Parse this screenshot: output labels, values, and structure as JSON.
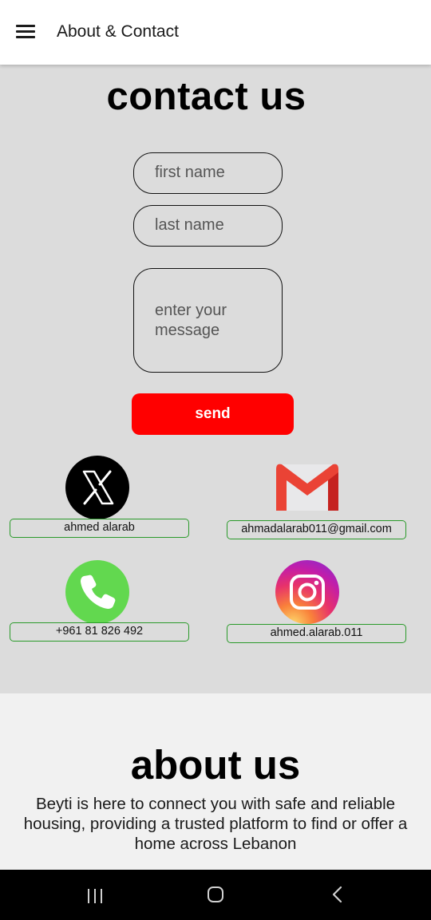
{
  "appbar": {
    "title": "About & Contact",
    "menu_icon": "hamburger-menu-icon"
  },
  "contact": {
    "title": "contact us",
    "form": {
      "first_name_placeholder": "first name",
      "last_name_placeholder": "last name",
      "message_placeholder": "enter your\nmessage",
      "send_label": "send"
    },
    "links": [
      {
        "icon": "x-twitter-icon",
        "label": "ahmed alarab"
      },
      {
        "icon": "gmail-icon",
        "label": "ahmadalarab011@gmail.com"
      },
      {
        "icon": "phone-icon",
        "label": "+961 81 826 492"
      },
      {
        "icon": "instagram-icon",
        "label": "ahmed.alarab.011"
      }
    ]
  },
  "about": {
    "title": "about us",
    "text": "Beyti is here to connect you with safe and reliable housing, providing a trusted platform to find or offer a home across Lebanon"
  },
  "colors": {
    "accent": "#ff0000",
    "contact_bg": "#dcdcdc",
    "about_bg": "#f1f1f1",
    "label_border": "#2a9a2a"
  },
  "system_nav": {
    "recents_icon": "recents-icon",
    "home_icon": "home-icon",
    "back_icon": "back-icon"
  }
}
